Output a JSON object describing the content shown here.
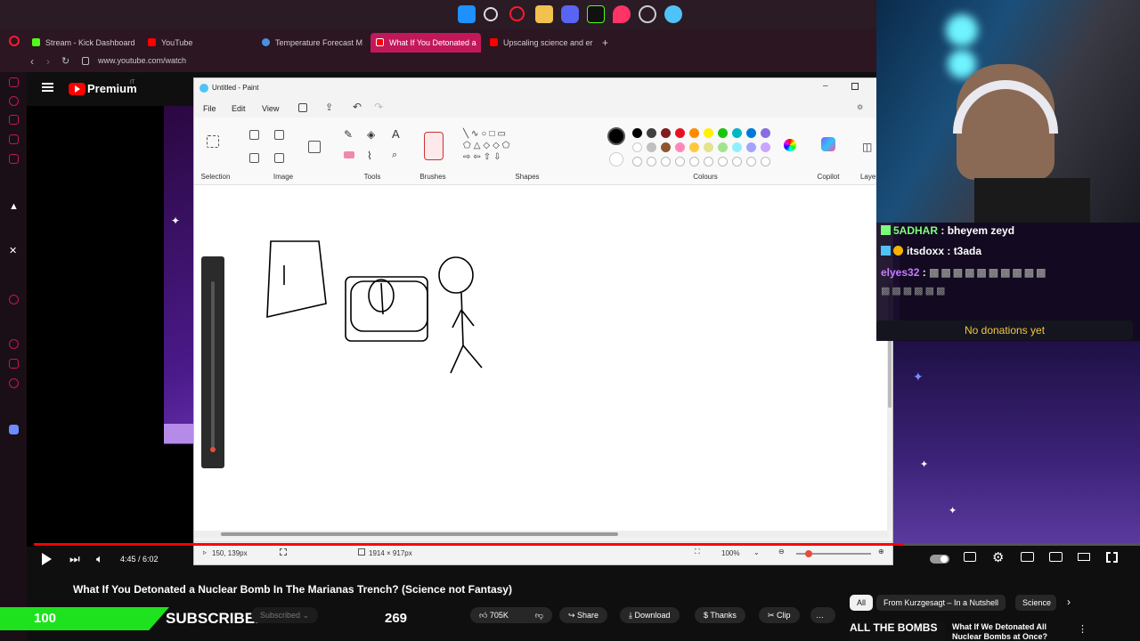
{
  "browser": {
    "tabs": [
      {
        "label": "Stream - Kick Dashboard",
        "color": "#53fc18"
      },
      {
        "label": "YouTube",
        "color": "#ff0000"
      },
      {
        "label": "Temperature Forecast M",
        "color": "#4a90e2"
      },
      {
        "label": "What If You Detonated a",
        "color": "#ff0000"
      },
      {
        "label": "Upscaling science and er",
        "color": "#ff0000"
      }
    ],
    "new_tab": "+",
    "url": "www.youtube.com/watch"
  },
  "youtube": {
    "logo_text": "Premium",
    "logo_sup": "IT",
    "time": "4:45 / 6:02",
    "video_title": "What If You Detonated a Nuclear Bomb In The Marianas Trench? (Science not Fantasy)",
    "subscribed": "Subscribed",
    "likes": "705K",
    "share": "Share",
    "download": "Download",
    "thanks": "Thanks",
    "clip": "Clip",
    "more": "…",
    "chips": [
      "All",
      "From Kurzgesagt – In a Nutshell",
      "Science"
    ],
    "related_thumb_title": "ALL THE BOMBS",
    "related_title": "What If We Detonated All Nuclear Bombs at Once?"
  },
  "overlay": {
    "sub_count": "100",
    "sub_label": "SUBSCRIBERS",
    "sub_total": "269",
    "no_donations": "No donations yet",
    "chat": [
      {
        "user": "5ADHAR",
        "msg": "bheyem zeyd",
        "color": "#7cff7c"
      },
      {
        "user": "itsdoxx",
        "msg": "t3ada",
        "color": "#ffffff"
      },
      {
        "user": "elyes32",
        "msg": "",
        "color": "#c87cff"
      }
    ]
  },
  "paint": {
    "title": "Untitled - Paint",
    "menu": [
      "File",
      "Edit",
      "View"
    ],
    "groups": [
      "Selection",
      "Image",
      "Tools",
      "Brushes",
      "Shapes",
      "Colours",
      "Copilot",
      "Layers"
    ],
    "colors_row1": [
      "#000000",
      "#404040",
      "#7f1d1d",
      "#e81123",
      "#ff8c00",
      "#fff100",
      "#16c60c",
      "#00b7c3",
      "#0078d7",
      "#886ce4"
    ],
    "colors_row2": [
      "#ffffff",
      "#c0c0c0",
      "#8e562e",
      "#ff88b9",
      "#ffc83d",
      "#e3e48d",
      "#a0e48d",
      "#8ef0ff",
      "#a3a4ff",
      "#c9a6ff"
    ],
    "cursor_pos": "150, 139px",
    "canvas_size": "1914 × 917px",
    "zoom": "100%"
  }
}
